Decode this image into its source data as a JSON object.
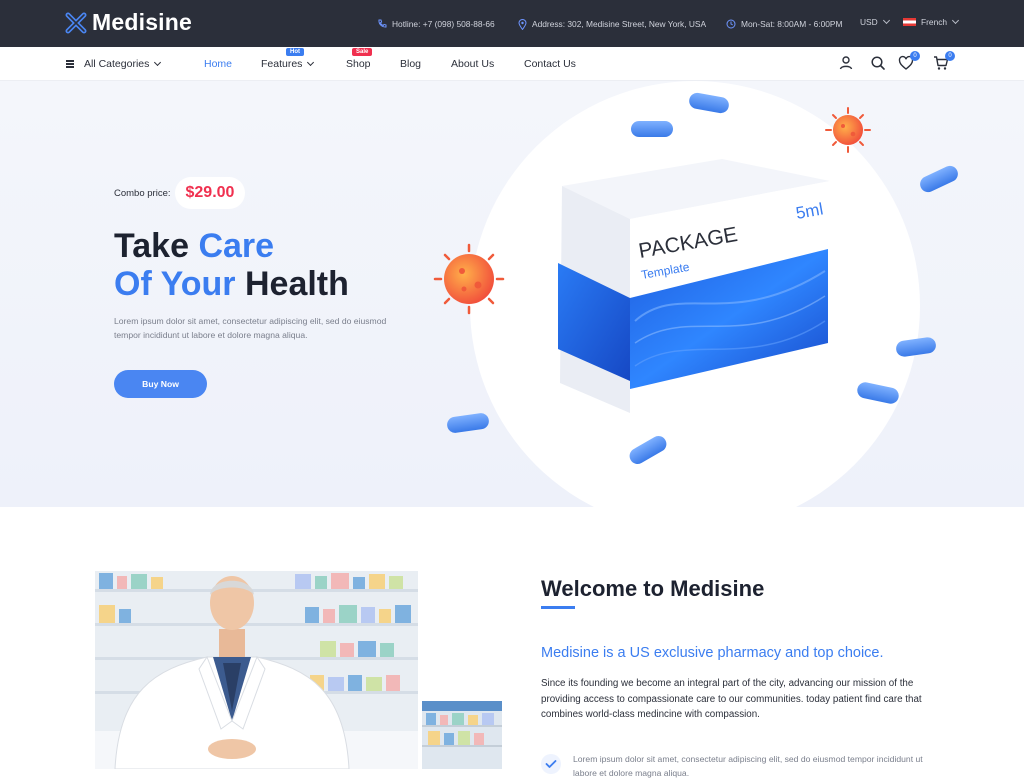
{
  "brand": {
    "name": "Medisine"
  },
  "topbar": {
    "hotline": "Hotline: +7 (098) 508-88-66",
    "address": "Address: 302, Medisine Street, New York, USA",
    "hours": "Mon-Sat: 8:00AM - 6:00PM",
    "currency": "USD",
    "language": "French"
  },
  "nav": {
    "all_categories": "All Categories",
    "items": [
      {
        "label": "Home",
        "active": true
      },
      {
        "label": "Features",
        "badge": "Hot"
      },
      {
        "label": "Shop",
        "badge": "Sale"
      },
      {
        "label": "Blog"
      },
      {
        "label": "About Us"
      },
      {
        "label": "Contact Us"
      }
    ],
    "wishlist_count": "0",
    "cart_count": "0"
  },
  "hero": {
    "combo_label": "Combo price:",
    "combo_price": "$29.00",
    "headline_line1_dark": "Take",
    "headline_line1_blue": "Care",
    "headline_line2_blue": "Of Your",
    "headline_line2_dark": "Health",
    "description": "Lorem ipsum dolor sit amet, consectetur adipiscing elit, sed do eiusmod tempor incididunt ut labore et dolore magna aliqua.",
    "button": "Buy Now",
    "package_title": "PACKAGE",
    "package_subtitle": "Template",
    "package_volume": "5ml"
  },
  "welcome": {
    "title": "Welcome to Medisine",
    "subtitle": "Medisine is a US exclusive pharmacy and top choice.",
    "body": "Since its founding we become an integral part of the city, advancing our mission of the providing access to compassionate care to our communities. today patient find care that combines world-class medincine with compassion.",
    "feature_1": "Lorem ipsum dolor sit amet, consectetur adipiscing elit, sed do eiusmod tempor incididunt ut labore et dolore magna aliqua."
  },
  "colors": {
    "accent": "#3b7df0",
    "sale": "#f0304f",
    "topbar": "#2b2f3a"
  }
}
